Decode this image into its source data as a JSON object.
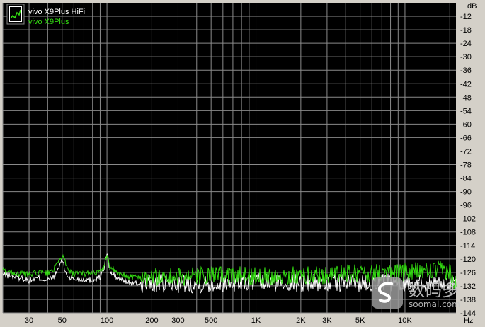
{
  "chart_data": {
    "type": "line",
    "x_scale": "log",
    "xlim": [
      20,
      22000
    ],
    "ylim": [
      -144,
      -6
    ],
    "x_unit_label": "Hz",
    "y_unit_label": "dB",
    "x_ticks": [
      {
        "value": 30,
        "label": "30"
      },
      {
        "value": 50,
        "label": "50"
      },
      {
        "value": 100,
        "label": "100"
      },
      {
        "value": 200,
        "label": "200"
      },
      {
        "value": 300,
        "label": "300"
      },
      {
        "value": 500,
        "label": "500"
      },
      {
        "value": 1000,
        "label": "1K"
      },
      {
        "value": 2000,
        "label": "2K"
      },
      {
        "value": 3000,
        "label": "3K"
      },
      {
        "value": 5000,
        "label": "5K"
      },
      {
        "value": 10000,
        "label": "10K"
      }
    ],
    "x_gridlines": [
      20,
      30,
      40,
      50,
      60,
      70,
      80,
      90,
      100,
      200,
      300,
      400,
      500,
      600,
      700,
      800,
      900,
      1000,
      2000,
      3000,
      4000,
      5000,
      6000,
      7000,
      8000,
      9000,
      10000,
      20000
    ],
    "y_ticks": [
      -12,
      -18,
      -24,
      -30,
      -36,
      -42,
      -48,
      -54,
      -60,
      -66,
      -72,
      -78,
      -84,
      -90,
      -96,
      -102,
      -108,
      -114,
      -120,
      -126,
      -132,
      -138,
      -144
    ],
    "grid": true,
    "background": "#000000",
    "grid_color": "#8a8a8a",
    "legend_position": "top-left",
    "series": [
      {
        "name": "vivo X9Plus HiFi",
        "color": "#ffffff",
        "points": [
          [
            20,
            -127
          ],
          [
            25,
            -128
          ],
          [
            30,
            -129.5
          ],
          [
            35,
            -128.5
          ],
          [
            40,
            -129.5
          ],
          [
            45,
            -127.5
          ],
          [
            48,
            -123
          ],
          [
            50,
            -120
          ],
          [
            52,
            -125
          ],
          [
            55,
            -128
          ],
          [
            60,
            -129
          ],
          [
            70,
            -129
          ],
          [
            80,
            -129.5
          ],
          [
            90,
            -128
          ],
          [
            95,
            -125
          ],
          [
            100,
            -117
          ],
          [
            105,
            -126
          ],
          [
            120,
            -129
          ],
          [
            150,
            -131
          ],
          [
            200,
            -131
          ],
          [
            300,
            -131
          ],
          [
            500,
            -131
          ],
          [
            700,
            -130.5
          ],
          [
            1000,
            -130.5
          ],
          [
            2000,
            -130.5
          ],
          [
            3000,
            -130.5
          ],
          [
            5000,
            -130.5
          ],
          [
            10000,
            -130.5
          ],
          [
            20000,
            -130.5
          ]
        ]
      },
      {
        "name": "vivo X9Plus",
        "color": "#33dd11",
        "points": [
          [
            20,
            -125
          ],
          [
            25,
            -126.5
          ],
          [
            30,
            -127
          ],
          [
            35,
            -126
          ],
          [
            40,
            -126.5
          ],
          [
            45,
            -124
          ],
          [
            48,
            -121
          ],
          [
            50,
            -118
          ],
          [
            52,
            -121
          ],
          [
            55,
            -125.5
          ],
          [
            60,
            -127
          ],
          [
            70,
            -126.5
          ],
          [
            80,
            -126
          ],
          [
            90,
            -126
          ],
          [
            95,
            -124
          ],
          [
            100,
            -117.5
          ],
          [
            105,
            -124
          ],
          [
            120,
            -127
          ],
          [
            150,
            -128
          ],
          [
            200,
            -128
          ],
          [
            300,
            -128
          ],
          [
            500,
            -127.5
          ],
          [
            1000,
            -127.5
          ],
          [
            2000,
            -127.5
          ],
          [
            3000,
            -127
          ],
          [
            5000,
            -126.5
          ],
          [
            10000,
            -126
          ],
          [
            18000,
            -125
          ],
          [
            20000,
            -125.5
          ],
          [
            21000,
            -131
          ],
          [
            22000,
            -131
          ]
        ]
      }
    ]
  },
  "watermark": {
    "cn_text": "数码多",
    "url_text": "soomal.com",
    "icon": "soomal-logo-icon"
  },
  "legend": {
    "icon": "spectrum-thumbnail-icon"
  }
}
